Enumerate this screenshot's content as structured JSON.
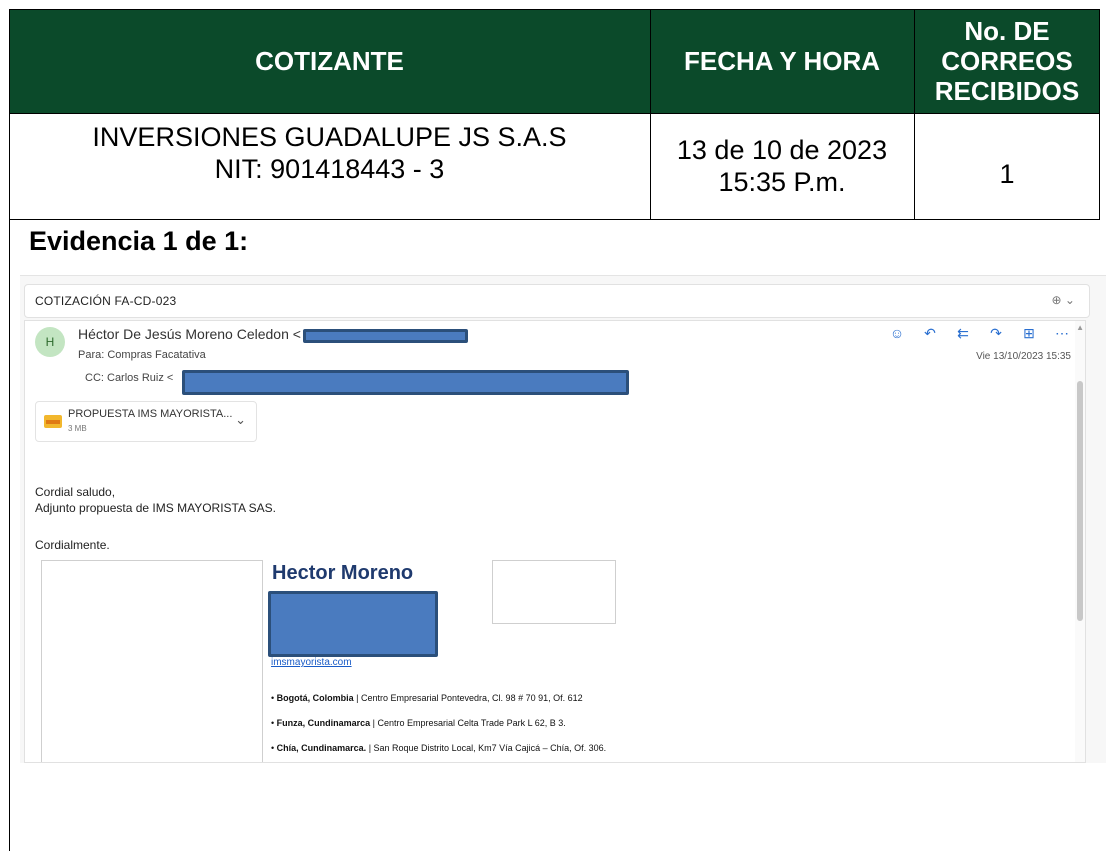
{
  "table": {
    "headers": {
      "cotizante": "COTIZANTE",
      "fecha": "FECHA Y HORA",
      "correos_line1": "No. DE",
      "correos_line2": "CORREOS",
      "correos_line3": "RECIBIDOS"
    },
    "row": {
      "company": "INVERSIONES GUADALUPE JS S.A.S",
      "nit": "NIT: 901418443 - 3",
      "date": "13 de 10 de 2023",
      "time": "15:35 P.m.",
      "count": "1"
    },
    "header_color": "#0b4a2a"
  },
  "evidence_label": "Evidencia 1 de 1:",
  "email": {
    "subject": "COTIZACIÓN FA-CD-023",
    "zoom_icon": "zoom-in-icon",
    "avatar_initial": "H",
    "sender": "Héctor De Jesús Moreno Celedon <",
    "to": "Para:  Compras Facatativa",
    "cc": "CC:  Carlos Ruiz <",
    "date": "Vie 13/10/2023 15:35",
    "actions": [
      "smiley-icon",
      "reply-icon",
      "reply-all-icon",
      "forward-icon",
      "apps-icon",
      "more-icon"
    ],
    "attachment": {
      "name": "PROPUESTA IMS MAYORISTA...",
      "size": "3 MB"
    },
    "body": {
      "greeting": "Cordial saludo,",
      "line": "Adjunto propuesta de IMS MAYORISTA SAS.",
      "closing": "Cordialmente."
    },
    "signature": {
      "name": "Hector Moreno",
      "link": "imsmayorista.com",
      "addresses": [
        {
          "city": "Bogotá, Colombia",
          "detail": " | Centro Empresarial Pontevedra, Cl. 98 # 70 91, Of. 612"
        },
        {
          "city": "Funza, Cundinamarca",
          "detail": " | Centro Empresarial Celta Trade Park L 62, B 3."
        },
        {
          "city": "Chía, Cundinamarca.",
          "detail": " | San Roque Distrito Local, Km7 Vía Cajicá – Chía, Of. 306."
        }
      ]
    },
    "redaction_color": "#4a7bbf"
  }
}
